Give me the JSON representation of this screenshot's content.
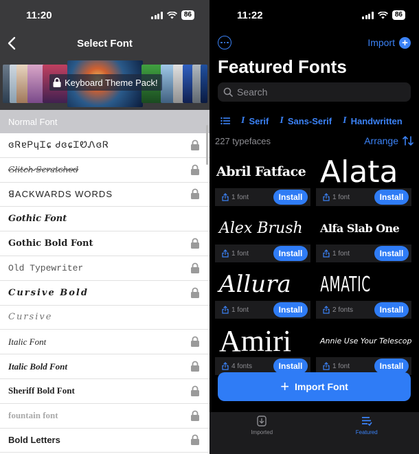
{
  "left": {
    "status": {
      "time": "11:20",
      "battery": "86"
    },
    "nav": {
      "title": "Select Font"
    },
    "banner": {
      "label": "Keyboard Theme Pack!"
    },
    "section_header": "Normal Font",
    "fonts": [
      {
        "label": "ɞᏒɐᏢɥᏆɕ ᏧɞɕᏆᏬᏁɞᏒ",
        "locked": true
      },
      {
        "label": "Glitch Scratched",
        "locked": true
      },
      {
        "label": "ꓭACKWARDS WORDS",
        "locked": true
      },
      {
        "label": "Gothic Font",
        "locked": false
      },
      {
        "label": "Gothic Bold Font",
        "locked": true
      },
      {
        "label": "Old Typewriter",
        "locked": true
      },
      {
        "label": "Cursive Bold",
        "locked": true
      },
      {
        "label": "Cursive",
        "locked": false
      },
      {
        "label": "Italic Font",
        "locked": true
      },
      {
        "label": "Italic Bold Font",
        "locked": true
      },
      {
        "label": "Sheriff Bold Font",
        "locked": true
      },
      {
        "label": "fountain font",
        "locked": true
      },
      {
        "label": "Bold Letters",
        "locked": true
      }
    ]
  },
  "right": {
    "status": {
      "time": "11:22",
      "battery": "86"
    },
    "import_link": "Import",
    "title": "Featured Fonts",
    "search_placeholder": "Search",
    "filters": [
      "Serif",
      "Sans-Serif",
      "Handwritten"
    ],
    "count": "227 typefaces",
    "arrange": "Arrange",
    "cards": [
      {
        "preview": "Abril Fatface",
        "fonts": "1 font",
        "install": "Install"
      },
      {
        "preview": "Alata",
        "fonts": "1 font",
        "install": "Install"
      },
      {
        "preview": "Alex Brush",
        "fonts": "1 font",
        "install": "Install"
      },
      {
        "preview": "Alfa Slab One",
        "fonts": "1 font",
        "install": "Install"
      },
      {
        "preview": "Allura",
        "fonts": "1 font",
        "install": "Install"
      },
      {
        "preview": "AMATIC SC",
        "fonts": "2 fonts",
        "install": "Install"
      },
      {
        "preview": "Amiri",
        "fonts": "4 fonts",
        "install": "Install"
      },
      {
        "preview": "Annie Use Your Telescope",
        "fonts": "1 font",
        "install": "Install"
      }
    ],
    "import_font_button": "Import Font",
    "tabs": [
      {
        "label": "Imported",
        "active": false
      },
      {
        "label": "Featured",
        "active": true
      }
    ]
  },
  "colors": {
    "accent": "#2f7cf6",
    "left_header": "#3a3a3c",
    "section_gray": "#c8c8cc"
  }
}
